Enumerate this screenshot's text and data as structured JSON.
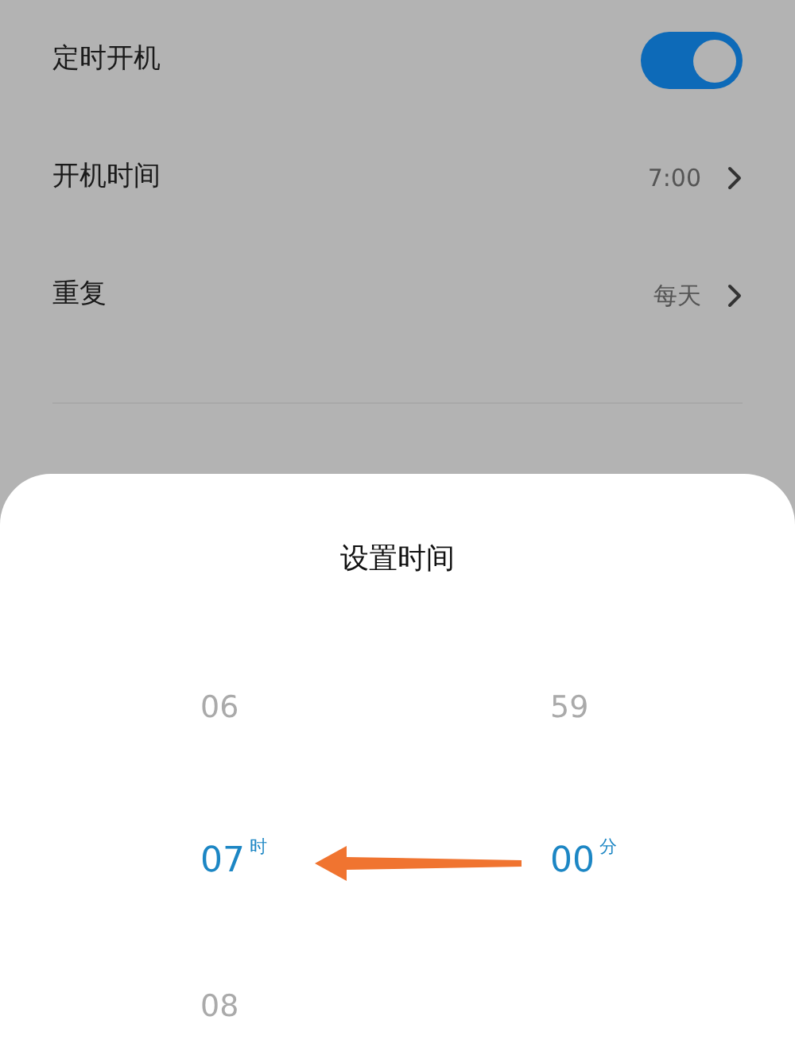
{
  "settings": [
    {
      "kind": "toggle",
      "label": "定时开机",
      "on": true
    },
    {
      "kind": "link",
      "label": "开机时间",
      "value": "7:00"
    },
    {
      "kind": "link",
      "label": "重复",
      "value": "每天"
    }
  ],
  "sheet": {
    "title": "设置时间",
    "columns": [
      {
        "unit": "时",
        "items": [
          {
            "label": "06",
            "selected": false
          },
          {
            "label": "07",
            "selected": true
          },
          {
            "label": "08",
            "selected": false
          }
        ]
      },
      {
        "unit": "分",
        "items": [
          {
            "label": "59",
            "selected": false
          },
          {
            "label": "00",
            "selected": true
          }
        ]
      }
    ]
  }
}
